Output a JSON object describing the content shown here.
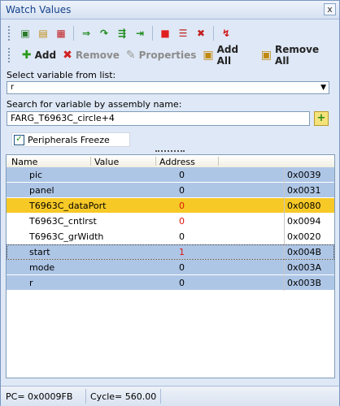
{
  "window": {
    "title": "Watch Values",
    "close_glyph": "x"
  },
  "toolbar_top": {
    "icons": [
      "add-item-icon",
      "copy-icon",
      "delete-item-icon",
      "run-icon",
      "step-over-icon",
      "step-into-icon",
      "run-to-cursor-icon",
      "stop-icon",
      "list-icon",
      "remove-icon",
      "reset-icon"
    ]
  },
  "toolbar": {
    "add_label": "Add",
    "remove_label": "Remove",
    "properties_label": "Properties",
    "add_all_label": "Add All",
    "remove_all_label": "Remove All"
  },
  "select_variable": {
    "label": "Select variable from list:",
    "value": "r"
  },
  "search": {
    "label": "Search for variable by assembly name:",
    "value": "FARG_T6963C_circle+4"
  },
  "freeze": {
    "label": "Peripherals Freeze",
    "checked": true
  },
  "grid": {
    "columns": [
      "Name",
      "Value",
      "Address"
    ],
    "rows": [
      {
        "name": "pic",
        "value": "0",
        "address": "0x0039",
        "style": "blue",
        "changed": false
      },
      {
        "name": "panel",
        "value": "0",
        "address": "0x0031",
        "style": "blue",
        "changed": false
      },
      {
        "name": "T6963C_dataPort",
        "value": "0",
        "address": "0x0080",
        "style": "selected",
        "changed": true
      },
      {
        "name": "T6963C_cntlrst",
        "value": "0",
        "address": "0x0094",
        "style": "white",
        "changed": true
      },
      {
        "name": "T6963C_grWidth",
        "value": "0",
        "address": "0x0020",
        "style": "white",
        "changed": false
      },
      {
        "name": "start",
        "value": "1",
        "address": "0x004B",
        "style": "blue",
        "changed": true
      },
      {
        "name": "mode",
        "value": "0",
        "address": "0x003A",
        "style": "blue",
        "changed": false
      },
      {
        "name": "r",
        "value": "0",
        "address": "0x003B",
        "style": "blue",
        "changed": false
      }
    ]
  },
  "status": {
    "pc": "PC= 0x0009FB",
    "cycle": "Cycle= 560.00"
  }
}
